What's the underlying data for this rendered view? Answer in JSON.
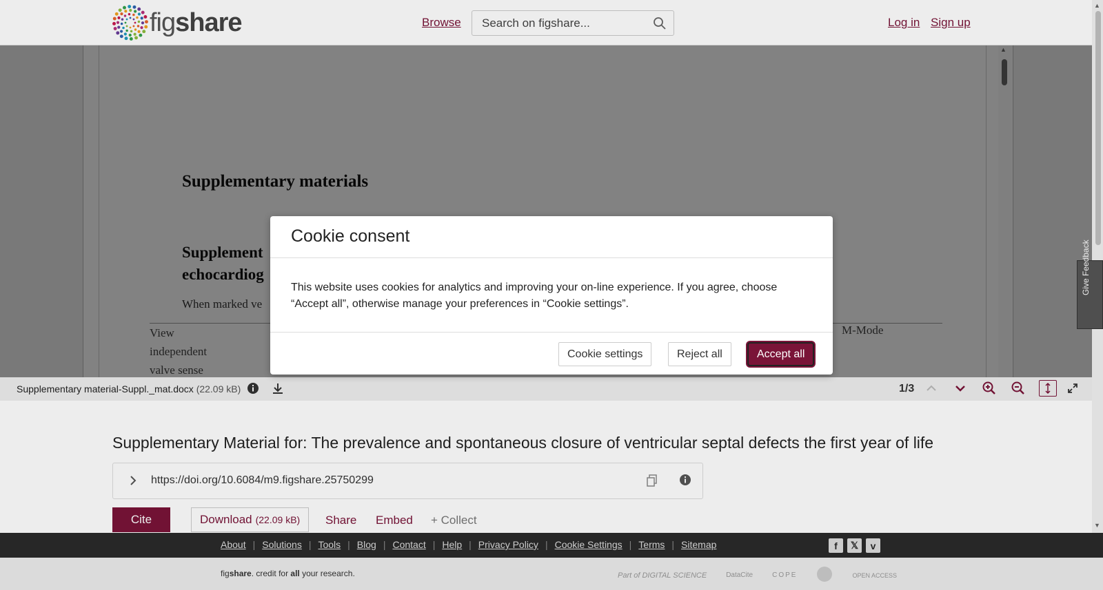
{
  "header": {
    "logo_fig": "fig",
    "logo_share": "share",
    "browse": "Browse",
    "search_placeholder": "Search on figshare...",
    "login": "Log in",
    "signup": "Sign up"
  },
  "document": {
    "heading1": "Supplementary materials",
    "heading2_line1": "Supplement",
    "heading2_line2": "echocardiog",
    "paragraph": "When marked ve",
    "table_col1_row1": "View",
    "table_col1_row2": "independent",
    "table_col1_row3": "valve sense",
    "table_right": "M-Mode"
  },
  "viewer_bar": {
    "file_name": "Supplementary material-Suppl._mat.docx",
    "file_size": "(22.09 kB)",
    "page_indicator": "1/3"
  },
  "item": {
    "title": "Supplementary Material for: The prevalence and spontaneous closure of ventricular septal defects the first year of life",
    "doi": "https://doi.org/10.6084/m9.figshare.25750299",
    "cite": "Cite",
    "download": "Download",
    "download_size": "(22.09 kB)",
    "share": "Share",
    "embed": "Embed",
    "collect": "+ Collect"
  },
  "feedback": "Give Feedback",
  "footer": {
    "links": [
      "About",
      "Solutions",
      "Tools",
      "Blog",
      "Contact",
      "Help",
      "Privacy Policy",
      "Cookie Settings",
      "Terms",
      "Sitemap"
    ],
    "credit_fig": "fig",
    "credit_share": "share",
    "credit_mid": ". credit for ",
    "credit_all": "all",
    "credit_end": " your research.",
    "partners": [
      "Part of DIGITAL SCIENCE",
      "DataCite",
      "COPE",
      "",
      "OPEN ACCESS"
    ]
  },
  "cookie_modal": {
    "title": "Cookie consent",
    "body": "This website uses cookies for analytics and improving your on-line experience. If you agree, choose “Accept all”, otherwise manage your preferences in “Cookie settings”.",
    "settings_button": "Cookie settings",
    "reject_button": "Reject all",
    "accept_button": "Accept all"
  },
  "colors": {
    "brand": "#7a1438",
    "footer_dark": "#2b2b2b"
  }
}
